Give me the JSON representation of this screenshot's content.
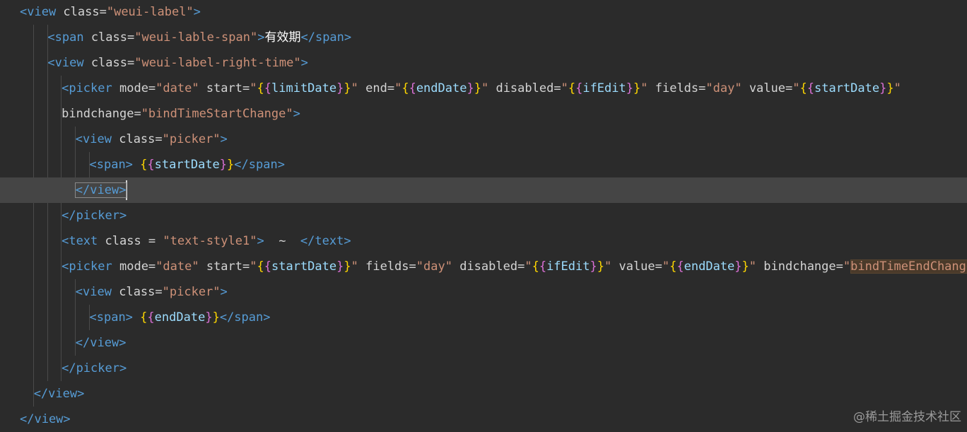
{
  "editor": {
    "lines": [
      {
        "indent": 0,
        "tokens": [
          [
            "tag",
            "<view"
          ],
          [
            "attr",
            " class="
          ],
          [
            "str",
            "\"weui-label\""
          ],
          [
            "tag",
            ">"
          ]
        ]
      },
      {
        "indent": 2,
        "tokens": [
          [
            "tag",
            "<span"
          ],
          [
            "attr",
            " class="
          ],
          [
            "str",
            "\"weui-lable-span\""
          ],
          [
            "tag",
            ">"
          ],
          [
            "text",
            "有效期"
          ],
          [
            "tag",
            "</span>"
          ]
        ]
      },
      {
        "indent": 2,
        "tokens": [
          [
            "tag",
            "<view"
          ],
          [
            "attr",
            " class="
          ],
          [
            "str",
            "\"weui-label-right-time\""
          ],
          [
            "tag",
            ">"
          ]
        ]
      },
      {
        "indent": 3,
        "tokens": [
          [
            "tag",
            "<picker"
          ],
          [
            "attr",
            " mode="
          ],
          [
            "str",
            "\"date\""
          ],
          [
            "attr",
            " start="
          ],
          [
            "str",
            "\""
          ],
          [
            "br1",
            "{"
          ],
          [
            "br2",
            "{"
          ],
          [
            "var",
            "limitDate"
          ],
          [
            "br2",
            "}"
          ],
          [
            "br1",
            "}"
          ],
          [
            "str",
            "\""
          ],
          [
            "attr",
            " end="
          ],
          [
            "str",
            "\""
          ],
          [
            "br1",
            "{"
          ],
          [
            "br2",
            "{"
          ],
          [
            "var",
            "endDate"
          ],
          [
            "br2",
            "}"
          ],
          [
            "br1",
            "}"
          ],
          [
            "str",
            "\""
          ],
          [
            "attr",
            " disabled="
          ],
          [
            "str",
            "\""
          ],
          [
            "br1",
            "{"
          ],
          [
            "br2",
            "{"
          ],
          [
            "var",
            "ifEdit"
          ],
          [
            "br2",
            "}"
          ],
          [
            "br1",
            "}"
          ],
          [
            "str",
            "\""
          ],
          [
            "attr",
            " fields="
          ],
          [
            "str",
            "\"day\""
          ],
          [
            "attr",
            " value="
          ],
          [
            "str",
            "\""
          ],
          [
            "br1",
            "{"
          ],
          [
            "br2",
            "{"
          ],
          [
            "var",
            "startDate"
          ],
          [
            "br2",
            "}"
          ],
          [
            "br1",
            "}"
          ],
          [
            "str",
            "\""
          ]
        ]
      },
      {
        "indent": 3,
        "tokens": [
          [
            "attr",
            "bindchange="
          ],
          [
            "str",
            "\"bindTimeStartChange\""
          ],
          [
            "tag",
            ">"
          ]
        ]
      },
      {
        "indent": 4,
        "tokens": [
          [
            "tag",
            "<view"
          ],
          [
            "attr",
            " class="
          ],
          [
            "str",
            "\"picker\""
          ],
          [
            "tag",
            ">"
          ]
        ]
      },
      {
        "indent": 5,
        "tokens": [
          [
            "tag",
            "<span>"
          ],
          [
            "plain",
            " "
          ],
          [
            "br1",
            "{"
          ],
          [
            "br2",
            "{"
          ],
          [
            "var",
            "startDate"
          ],
          [
            "br2",
            "}"
          ],
          [
            "br1",
            "}"
          ],
          [
            "tag",
            "</span>"
          ]
        ]
      },
      {
        "indent": 4,
        "current": true,
        "tokens": [
          [
            "match",
            "</view>"
          ],
          [
            "cursor",
            ""
          ]
        ]
      },
      {
        "indent": 3,
        "tokens": [
          [
            "tag",
            "</picker>"
          ]
        ]
      },
      {
        "indent": 3,
        "tokens": [
          [
            "tag",
            "<text"
          ],
          [
            "attr",
            " class = "
          ],
          [
            "str",
            "\"text-style1\""
          ],
          [
            "tag",
            ">"
          ],
          [
            "plain",
            "  ~  "
          ],
          [
            "tag",
            "</text>"
          ]
        ]
      },
      {
        "indent": 3,
        "tokens": [
          [
            "tag",
            "<picker"
          ],
          [
            "attr",
            " mode="
          ],
          [
            "str",
            "\"date\""
          ],
          [
            "attr",
            " start="
          ],
          [
            "str",
            "\""
          ],
          [
            "br1",
            "{"
          ],
          [
            "br2",
            "{"
          ],
          [
            "var",
            "startDate"
          ],
          [
            "br2",
            "}"
          ],
          [
            "br1",
            "}"
          ],
          [
            "str",
            "\""
          ],
          [
            "attr",
            " fields="
          ],
          [
            "str",
            "\"day\""
          ],
          [
            "attr",
            " disabled="
          ],
          [
            "str",
            "\""
          ],
          [
            "br1",
            "{"
          ],
          [
            "br2",
            "{"
          ],
          [
            "var",
            "ifEdit"
          ],
          [
            "br2",
            "}"
          ],
          [
            "br1",
            "}"
          ],
          [
            "str",
            "\""
          ],
          [
            "attr",
            " value="
          ],
          [
            "str",
            "\""
          ],
          [
            "br1",
            "{"
          ],
          [
            "br2",
            "{"
          ],
          [
            "var",
            "endDate"
          ],
          [
            "br2",
            "}"
          ],
          [
            "br1",
            "}"
          ],
          [
            "str",
            "\""
          ],
          [
            "attr",
            " bindchange="
          ],
          [
            "str",
            "\""
          ],
          [
            "hl",
            "bindTimeEndChange"
          ],
          [
            "str",
            "\""
          ],
          [
            "tag",
            ">"
          ]
        ]
      },
      {
        "indent": 4,
        "tokens": [
          [
            "tag",
            "<view"
          ],
          [
            "attr",
            " class="
          ],
          [
            "str",
            "\"picker\""
          ],
          [
            "tag",
            ">"
          ]
        ]
      },
      {
        "indent": 5,
        "tokens": [
          [
            "tag",
            "<span>"
          ],
          [
            "plain",
            " "
          ],
          [
            "br1",
            "{"
          ],
          [
            "br2",
            "{"
          ],
          [
            "var",
            "endDate"
          ],
          [
            "br2",
            "}"
          ],
          [
            "br1",
            "}"
          ],
          [
            "tag",
            "</span>"
          ]
        ]
      },
      {
        "indent": 4,
        "tokens": [
          [
            "tag",
            "</view>"
          ]
        ]
      },
      {
        "indent": 3,
        "tokens": [
          [
            "tag",
            "</picker>"
          ]
        ]
      },
      {
        "indent": 1,
        "tokens": [
          [
            "tag",
            "</view>"
          ]
        ]
      },
      {
        "indent": 0,
        "tokens": [
          [
            "tag",
            "</view>"
          ]
        ]
      }
    ]
  },
  "watermark": "@稀土掘金技术社区",
  "colors": {
    "background": "#2b2b2b",
    "current_line": "#454545",
    "tag": "#569cd6",
    "string": "#ce9178",
    "bracket_outer": "#ffd700",
    "bracket_inner": "#da70d6",
    "variable": "#9cdcfe"
  }
}
